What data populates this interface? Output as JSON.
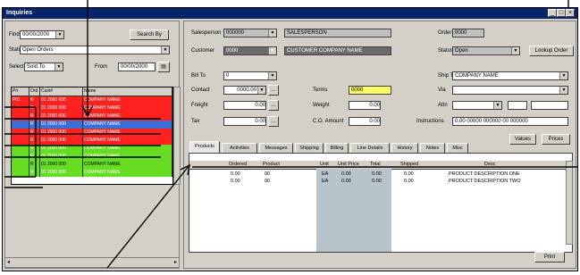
{
  "window": {
    "title": "Inquiries",
    "controls": [
      "_",
      "□",
      "×"
    ]
  },
  "left": {
    "find_label": "Find",
    "find_value": "00/00/2000",
    "find_button": "Search By",
    "status_label": "Status",
    "status_value": "Open Orders",
    "select_label": "Select",
    "select_value": "Sold To",
    "from_label": "From",
    "from_value": "00/00/2000",
    "columns": [
      "Pri",
      "Ord",
      "Cust#",
      "Name"
    ],
    "rows": [
      {
        "c0": "P01",
        "c1": "R",
        "c2": "01 2000 000",
        "c3": "COMPANY NAME",
        "color": "#ff2020",
        "text": "#ffffff"
      },
      {
        "c0": "",
        "c1": "R",
        "c2": "01 2000 000",
        "c3": "COMPANY NAME",
        "color": "#ff2020",
        "text": "#ffffff"
      },
      {
        "c0": "",
        "c1": "R",
        "c2": "01 2000 000",
        "c3": "COMPANY NAME",
        "color": "#ff2020",
        "text": "#ffffff"
      },
      {
        "c0": "",
        "c1": "R",
        "c2": "01 2000 000",
        "c3": "COMPANY NAME",
        "color": "#3a6fd8",
        "text": "#ffffff"
      },
      {
        "c0": "",
        "c1": "R",
        "c2": "01 2000 000",
        "c3": "COMPANY NAME",
        "color": "#ff2020",
        "text": "#ffffff"
      },
      {
        "c0": "",
        "c1": "R",
        "c2": "01 2000 000",
        "c3": "COMPANY NAME",
        "color": "#ff2020",
        "text": "#ffffff"
      },
      {
        "c0": "",
        "c1": "R",
        "c2": "01 2000 000",
        "c3": "COMPANY NAME",
        "color": "#66dd22",
        "text": "#ffffff"
      },
      {
        "c0": "",
        "c1": "R",
        "c2": "01 2000 000",
        "c3": "COMPANY NAME",
        "color": "#66dd22",
        "text": "#ffffff"
      },
      {
        "c0": "",
        "c1": "R",
        "c2": "01 2000 000",
        "c3": "COMPANY NAME",
        "color": "#66dd22",
        "text": "#000000"
      },
      {
        "c0": "",
        "c1": "R",
        "c2": "01 2000 000",
        "c3": "COMPANY NAME",
        "color": "#66dd22",
        "text": "#ffffff"
      }
    ]
  },
  "right": {
    "salesperson_label": "Salesperson",
    "salesperson_value": "000000",
    "salesperson_name": "SALESPERSON",
    "order_label": "Order #",
    "order_value": "0000",
    "customer_label": "Customer",
    "customer_value": "0000",
    "customer_name": "CUSTOMER COMPANY NAME",
    "status_label": "Status",
    "status_value": "Open",
    "ship_label": "Ship",
    "ship_value": "Open",
    "lookup_button": "Lookup Order",
    "bill_label": "Bill To",
    "bill_value": "0",
    "ship_to_label": "Ship To",
    "ship_to_value": "COMPANY NAME",
    "contact_label": "Contact",
    "contact_value": "0000.00",
    "terms_label": "Terms",
    "terms_value": "0000",
    "via_label": "Via",
    "via_value": "",
    "freight_label": "Freight",
    "freight_value": "0.00",
    "weight_label": "Weight",
    "weight_value": "0.00",
    "attn_label": "Attn",
    "attn_value": "",
    "tax_label": "Tax",
    "tax_value": "0.00",
    "cod_label": "C.O. Amount",
    "cod_value": "0.00",
    "instr_label": "Instructions",
    "instr_value": "0.00 00000 000000 00 000000",
    "values_button": "Values",
    "prices_button": "Prices",
    "tabs": [
      "Products",
      "Activities",
      "Messages",
      "Shipping",
      "Billing",
      "Line Details",
      "History",
      "Notes",
      "Misc"
    ],
    "table_columns": [
      "Ordered",
      "Product",
      "Unit",
      "Unit Price",
      "Total",
      "Shipped",
      "Desc"
    ],
    "table_rows": [
      {
        "c0": "0.00",
        "c1": "00",
        "c2": "EA",
        "c3": "0.00",
        "c4": "0.00",
        "c5": "0.00",
        "c6": "PRODUCT DESCRIPTION ONE"
      },
      {
        "c0": "0.00",
        "c1": "00",
        "c2": "EA",
        "c3": "0.00",
        "c4": "0.00",
        "c5": "0.00",
        "c6": "PRODUCT DESCRIPTION TWO"
      }
    ],
    "bottom_button": "Print"
  }
}
